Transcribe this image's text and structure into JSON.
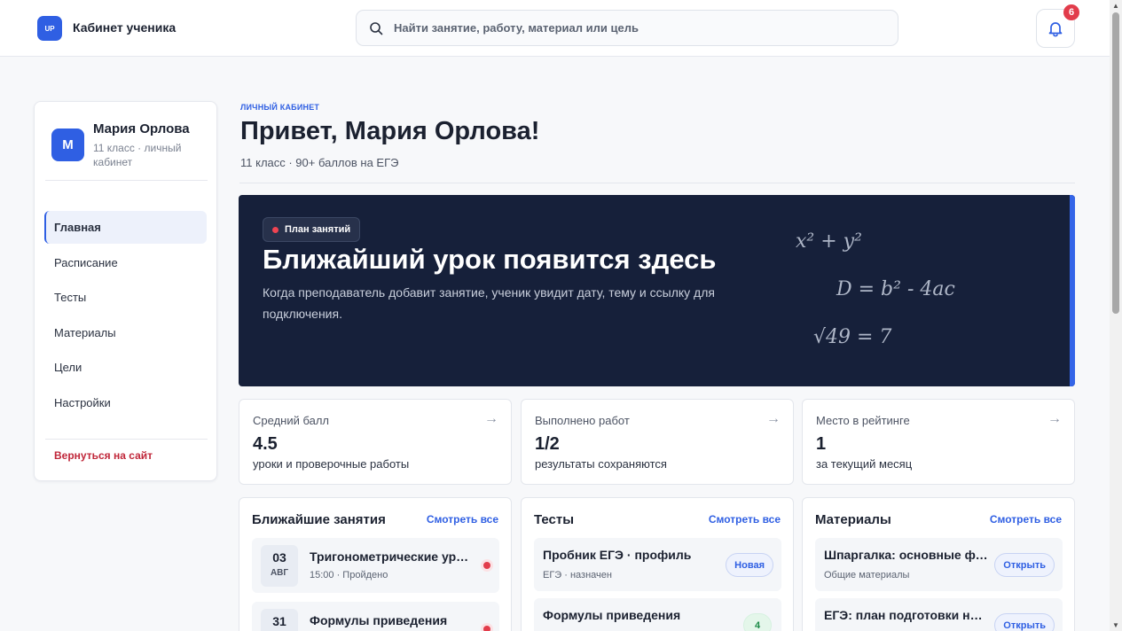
{
  "topbar": {
    "logo_text": "UP",
    "app_title": "Кабинет ученика",
    "search_placeholder": "Найти занятие, работу, материал или цель",
    "notifications_count": "6",
    "icons": [
      "search-icon",
      "bell-icon"
    ]
  },
  "sidebar": {
    "avatar_letter": "М",
    "user_name": "Мария Орлова",
    "user_sub": "11 класс · личный кабинет",
    "items": [
      {
        "label": "Главная",
        "active": true
      },
      {
        "label": "Расписание",
        "active": false
      },
      {
        "label": "Тесты",
        "active": false
      },
      {
        "label": "Материалы",
        "active": false
      },
      {
        "label": "Цели",
        "active": false
      },
      {
        "label": "Настройки",
        "active": false
      }
    ],
    "back_link": "Вернуться на сайт"
  },
  "header": {
    "eyebrow": "ЛИЧНЫЙ КАБИНЕТ",
    "title": "Привет, Мария Орлова!",
    "subtitle": "11 класс · 90+ баллов на ЕГЭ"
  },
  "hero": {
    "pill": "План занятий",
    "title": "Ближайший урок появится здесь",
    "text": "Когда преподаватель добавит занятие, ученик увидит дату, тему и ссылку для подключения.",
    "formulas": [
      "x² + y²",
      "D = b² - 4ac",
      "√49 = 7"
    ],
    "colors": {
      "background": "#16203a",
      "accent": "#3465e8"
    }
  },
  "stats": [
    {
      "label": "Средний балл",
      "value": "4.5",
      "desc": "уроки и проверочные работы",
      "arrow": "→"
    },
    {
      "label": "Выполнено работ",
      "value": "1/2",
      "desc": "результаты сохраняются",
      "arrow": "→"
    },
    {
      "label": "Место в рейтинге",
      "value": "1",
      "desc": "за текущий месяц",
      "arrow": "→"
    }
  ],
  "lessons": {
    "title": "Ближайшие занятия",
    "link": "Смотреть все",
    "items": [
      {
        "day": "03",
        "month": "АВГ",
        "title": "Тригонометрические уравнения",
        "sub": "15:00 · Пройдено"
      },
      {
        "day": "31",
        "month": "",
        "title": "Формулы приведения",
        "sub": ""
      }
    ]
  },
  "tests": {
    "title": "Тесты",
    "link": "Смотреть все",
    "items": [
      {
        "title": "Пробник ЕГЭ · профиль",
        "sub": "ЕГЭ · назначен",
        "tag": "Новая"
      },
      {
        "title": "Формулы приведения",
        "sub": "",
        "tag": "4"
      }
    ]
  },
  "materials": {
    "title": "Материалы",
    "link": "Смотреть все",
    "items": [
      {
        "title": "Шпаргалка: основные формулы",
        "sub": "Общие материалы",
        "tag": "Открыть"
      },
      {
        "title": "ЕГЭ: план подготовки на лето",
        "sub": "",
        "tag": "Открыть"
      }
    ]
  }
}
